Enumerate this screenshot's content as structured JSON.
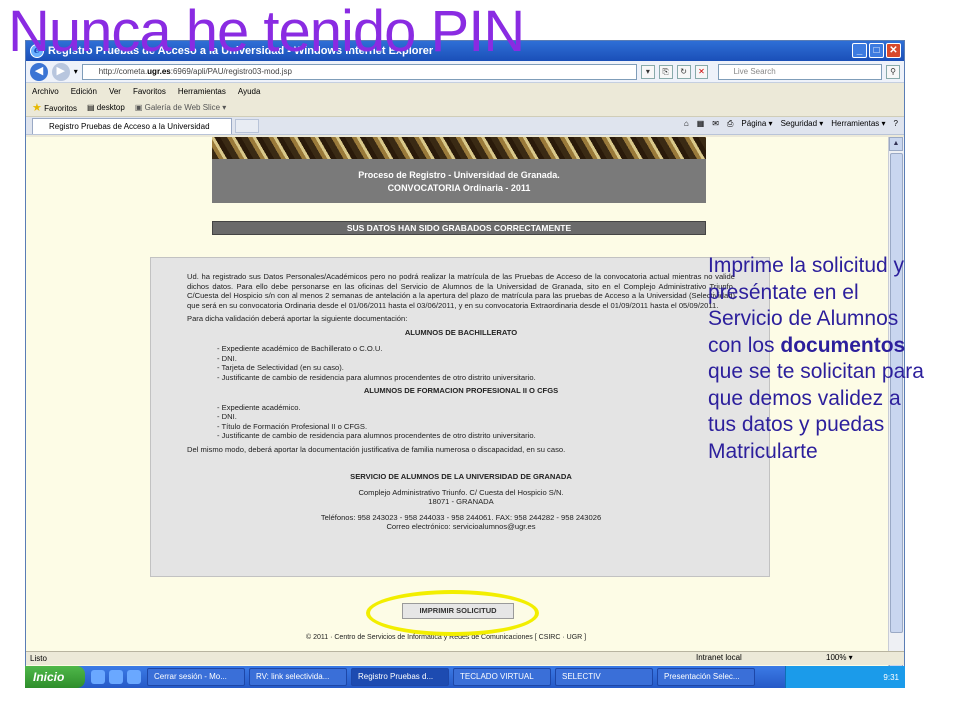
{
  "slide": {
    "title": "Nunca he tenido PIN",
    "callout_before": "Imprime la solicitud y preséntate en el Servicio de Alumnos con los ",
    "callout_bold": "documentos",
    "callout_after": " que se te solicitan para que demos validez a tus datos y puedas Matricularte"
  },
  "browser": {
    "window_title": "Registro Pruebas de Acceso a la Universidad - Windows Internet Explorer",
    "url_prefix": "http://cometa.",
    "url_host": "ugr.es",
    "url_suffix": ":6969/apli/PAU/registro03-mod.jsp",
    "search_placeholder": "Live Search",
    "menu": [
      "Archivo",
      "Edición",
      "Ver",
      "Favoritos",
      "Herramientas",
      "Ayuda"
    ],
    "favorites_label": "Favoritos",
    "fav_desktop": "desktop",
    "fav_gallery": "Galería de Web Slice ▾",
    "tab_label": "Registro Pruebas de Acceso a la Universidad",
    "cmd": [
      "Página ▾",
      "Seguridad ▾",
      "Herramientas ▾"
    ],
    "status_text": "Listo",
    "status_zone": "Intranet local",
    "status_zoom": "100% ▾"
  },
  "page": {
    "banner_line1": "Proceso de Registro - Universidad de Granada.",
    "banner_line2": "CONVOCATORIA Ordinaria - 2011",
    "saved_message": "SUS DATOS HAN SIDO GRABADOS CORRECTAMENTE",
    "intro": "Ud. ha registrado sus Datos Personales/Académicos pero no podrá realizar la matrícula de las Pruebas de Acceso de la convocatoria actual mientras no valide dichos datos. Para ello debe personarse en las oficinas del Servicio de Alumnos de la Universidad de Granada, sito en el Complejo Administrativo Triunfo. C/Cuesta del Hospicio s/n con al menos 2 semanas de antelación a la apertura del plazo de matrícula para las pruebas de Acceso a la Universidad (Selectividad) que será en su convocatoria Ordinaria desde el 01/06/2011 hasta el 03/06/2011, y en su convocatoria Extraordinaria desde el 01/09/2011 hasta el 05/09/2011.",
    "validation_note": "Para dicha validación deberá aportar la siguiente documentación:",
    "section1_title": "ALUMNOS DE BACHILLERATO",
    "section1_items": [
      "- Expediente académico de Bachillerato o C.O.U.",
      "- DNI.",
      "- Tarjeta de Selectividad (en su caso).",
      "- Justificante de cambio de residencia para alumnos procendentes de otro distrito universitario."
    ],
    "section2_title": "ALUMNOS DE FORMACION PROFESIONAL II O CFGS",
    "section2_items": [
      "- Expediente académico.",
      "- DNI.",
      "- Título de Formación Profesional II o CFGS.",
      "- Justificante de cambio de residencia para alumnos procendentes de otro distrito universitario."
    ],
    "extra_note": "Del mismo modo, deberá aportar la documentación justificativa de familia numerosa o discapacidad, en su caso.",
    "service_name": "SERVICIO DE ALUMNOS DE LA UNIVERSIDAD DE GRANADA",
    "address1": "Complejo Administrativo Triunfo. C/ Cuesta del Hospicio S/N.",
    "address2": "18071 - GRANADA",
    "phones": "Teléfonos: 958 243023 - 958 244033 - 958 244061. FAX: 958 244282 - 958 243026",
    "email": "Correo electrónico: servicioalumnos@ugr.es",
    "print_button": "IMPRIMIR SOLICITUD",
    "footer": "© 2011 · Centro de Servicios de Informática y Redes de Comunicaciones [ CSIRC · UGR ]"
  },
  "taskbar": {
    "start": "Inicio",
    "tasks": [
      "Cerrar sesión - Mo...",
      "RV: link selectivida...",
      "Registro Pruebas d...",
      "TECLADO VIRTUAL",
      "SELECTIV",
      "Presentación Selec..."
    ],
    "clock": "9:31"
  }
}
